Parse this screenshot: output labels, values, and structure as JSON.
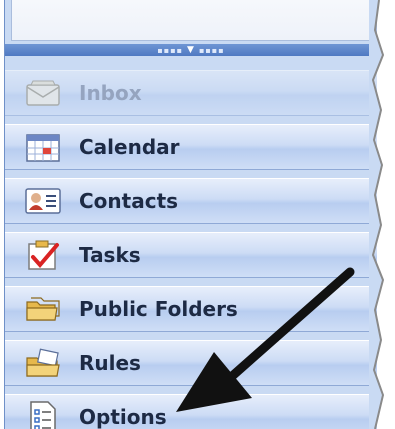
{
  "nav": {
    "items": [
      {
        "label": "Inbox",
        "icon": "inbox-icon"
      },
      {
        "label": "Calendar",
        "icon": "calendar-icon"
      },
      {
        "label": "Contacts",
        "icon": "contacts-icon"
      },
      {
        "label": "Tasks",
        "icon": "tasks-icon"
      },
      {
        "label": "Public Folders",
        "icon": "public-folders-icon"
      },
      {
        "label": "Rules",
        "icon": "rules-icon"
      },
      {
        "label": "Options",
        "icon": "options-icon"
      }
    ]
  },
  "colors": {
    "panel": "#c9daf3",
    "splitter": "#5a83c9",
    "label": "#1d2a44",
    "pointer_arrow": "#111111"
  }
}
